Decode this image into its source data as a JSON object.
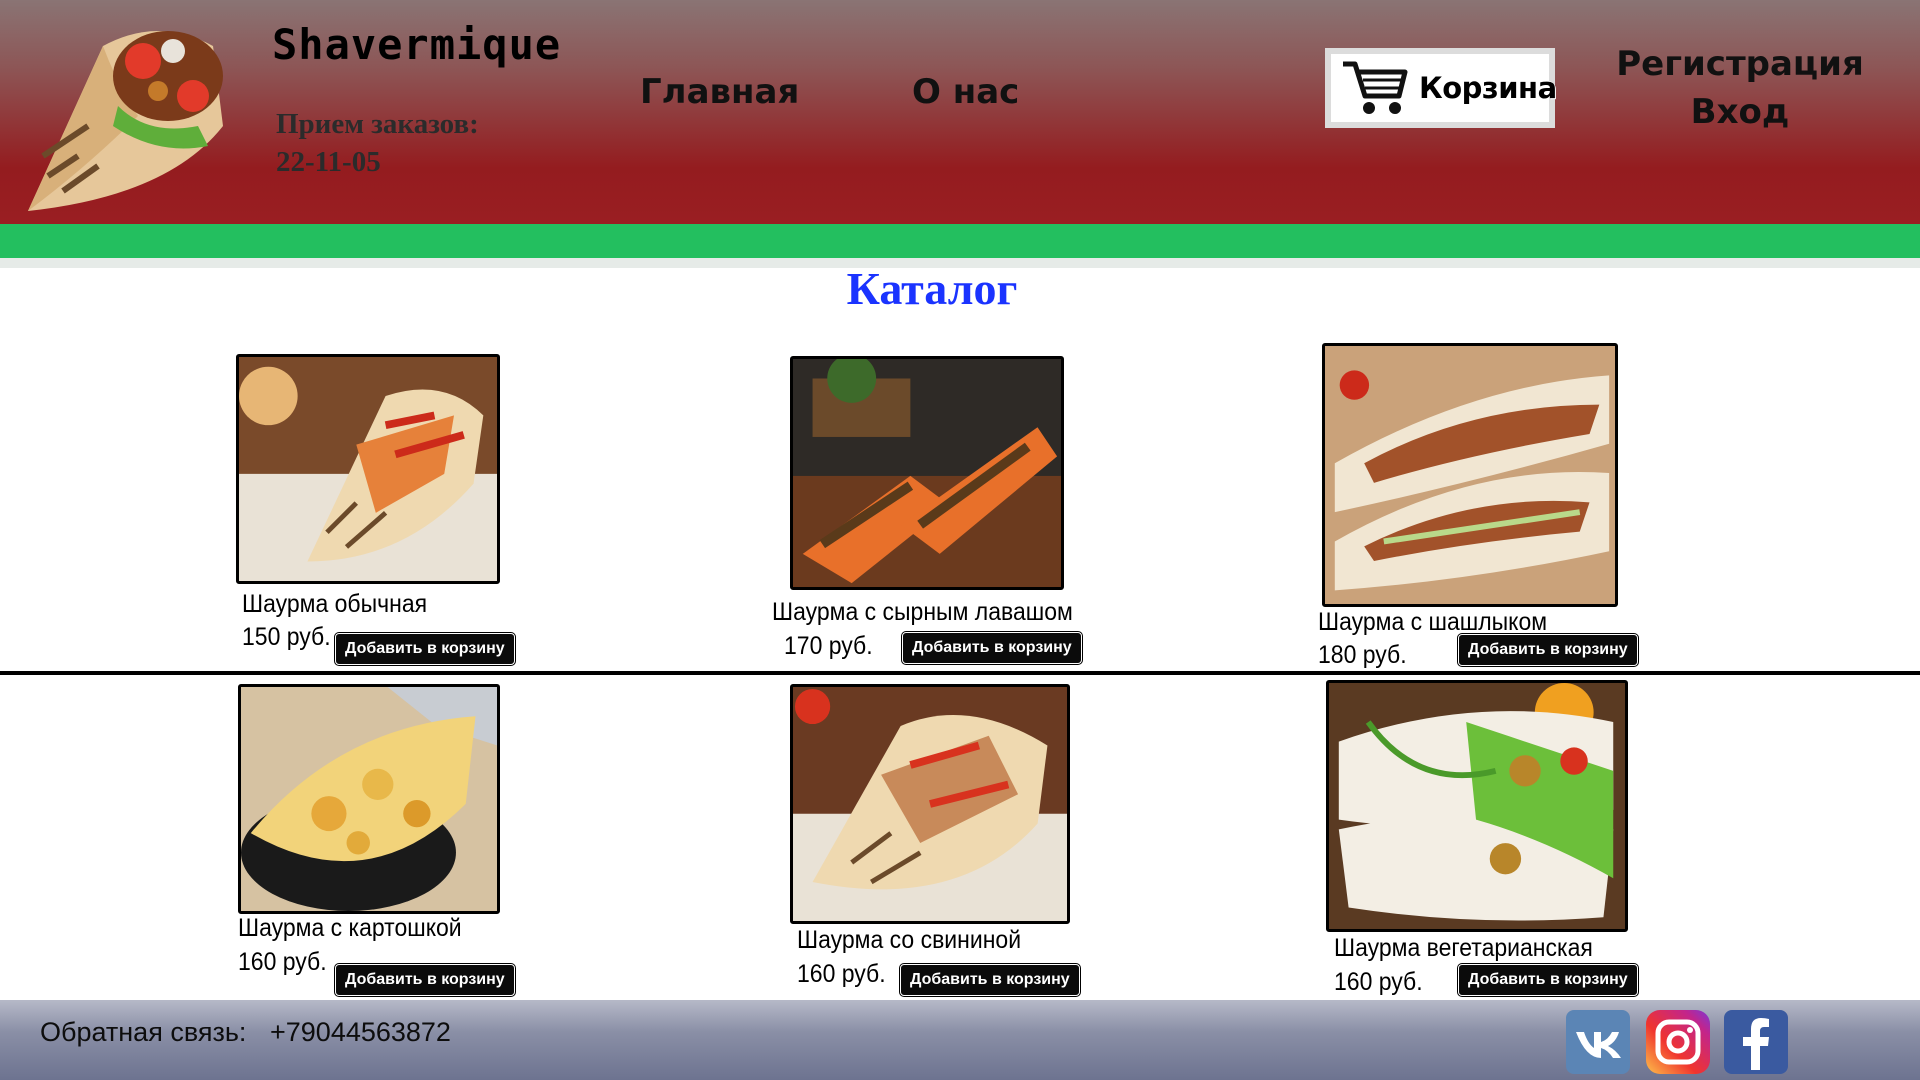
{
  "header": {
    "brand": "Shavermique",
    "hours_label": "Прием заказов:",
    "hours_value": "22-11-05",
    "nav": [
      {
        "label": "Главная"
      },
      {
        "label": "О нас"
      }
    ],
    "cart_label": "Корзина",
    "register_label": "Регистрация",
    "login_label": "Вход"
  },
  "catalog": {
    "title": "Каталог",
    "add_button_label": "Добавить в корзину",
    "items": [
      {
        "name": "Шаурма обычная",
        "price": "150 руб."
      },
      {
        "name": "Шаурма с сырным лавашом",
        "price": "170 руб."
      },
      {
        "name": "Шаурма с шашлыком",
        "price": "180 руб."
      },
      {
        "name": "Шаурма с картошкой",
        "price": "160 руб."
      },
      {
        "name": "Шаурма со свининой",
        "price": "160 руб."
      },
      {
        "name": "Шаурма вегетарианская",
        "price": "160 руб."
      }
    ]
  },
  "footer": {
    "feedback_label": "Обратная связь:",
    "phone": "+79044563872",
    "social": [
      {
        "icon": "vk-icon"
      },
      {
        "icon": "instagram-icon"
      },
      {
        "icon": "facebook-icon"
      }
    ]
  },
  "colors": {
    "header_red": "#941c1f",
    "green_bar": "#23bf5f",
    "catalog_title": "#1a33ff",
    "button_bg": "#0b0b0b"
  }
}
